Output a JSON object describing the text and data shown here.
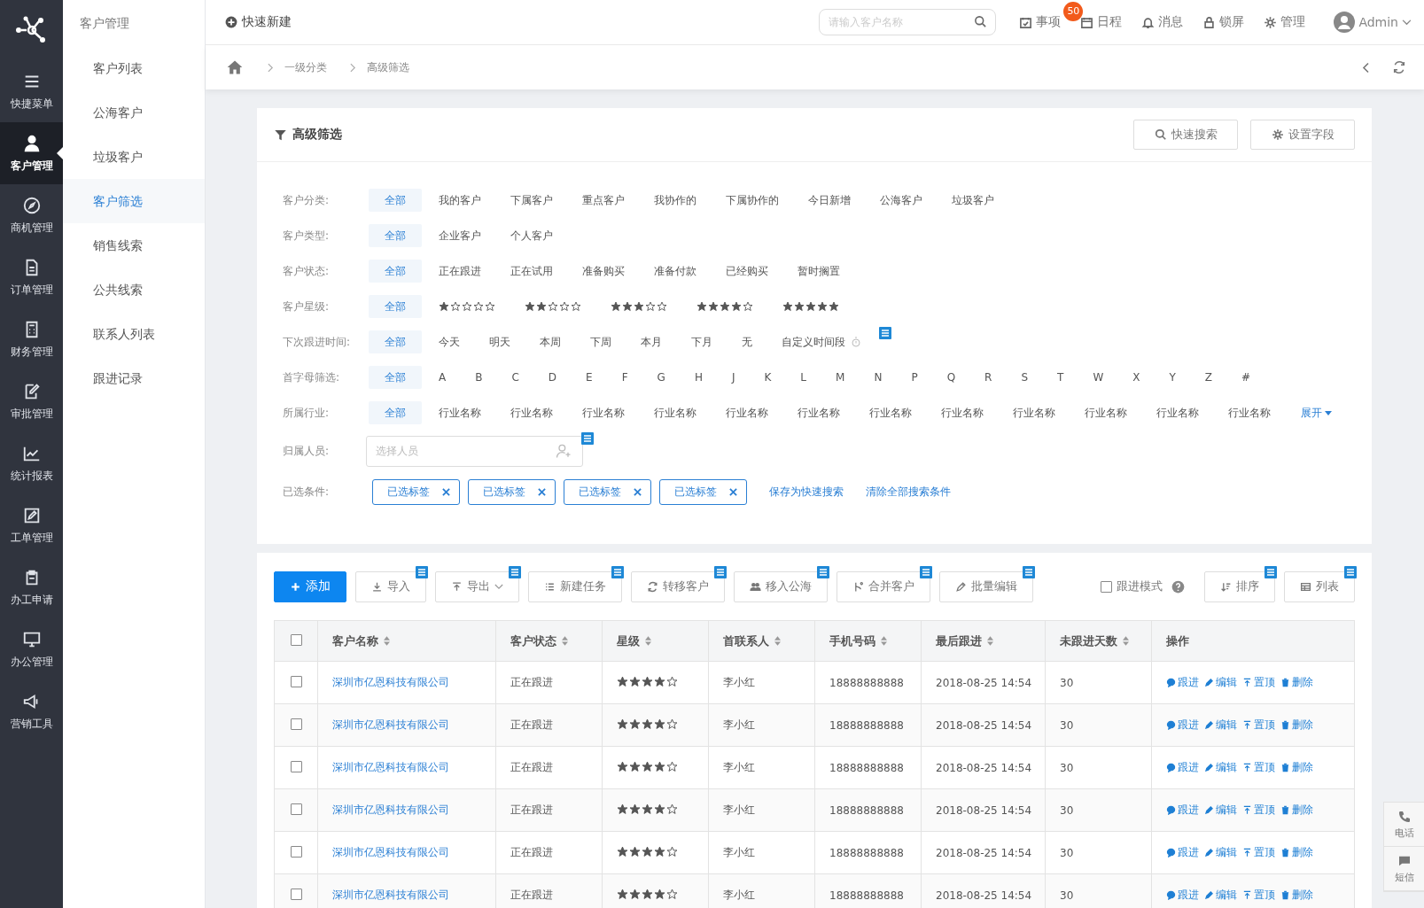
{
  "rail": {
    "items": [
      {
        "label": "快捷菜单",
        "selected": false
      },
      {
        "label": "客户管理",
        "selected": true
      },
      {
        "label": "商机管理",
        "selected": false
      },
      {
        "label": "订单管理",
        "selected": false
      },
      {
        "label": "财务管理",
        "selected": false
      },
      {
        "label": "审批管理",
        "selected": false
      },
      {
        "label": "统计报表",
        "selected": false
      },
      {
        "label": "工单管理",
        "selected": false
      },
      {
        "label": "办工申请",
        "selected": false
      },
      {
        "label": "办公管理",
        "selected": false
      },
      {
        "label": "营销工具",
        "selected": false
      }
    ]
  },
  "subnav": {
    "title": "客户管理",
    "items": [
      {
        "label": "客户列表",
        "selected": false
      },
      {
        "label": "公海客户",
        "selected": false
      },
      {
        "label": "垃圾客户",
        "selected": false
      },
      {
        "label": "客户筛选",
        "selected": true
      },
      {
        "label": "销售线索",
        "selected": false
      },
      {
        "label": "公共线索",
        "selected": false
      },
      {
        "label": "联系人列表",
        "selected": false
      },
      {
        "label": "跟进记录",
        "selected": false
      }
    ]
  },
  "topbar": {
    "quick_new": "快速新建",
    "search": {
      "placeholder": "请输入客户名称"
    },
    "actions": [
      {
        "label": "事项",
        "badge": "50"
      },
      {
        "label": "日程"
      },
      {
        "label": "消息"
      },
      {
        "label": "锁屏"
      },
      {
        "label": "管理"
      }
    ],
    "user": "Admin"
  },
  "breadcrumb": {
    "items": [
      "一级分类",
      "高级筛选"
    ]
  },
  "filter": {
    "title": "高级筛选",
    "buttons": [
      "快速搜索",
      "设置字段"
    ],
    "rows": [
      {
        "label": "客户分类:",
        "kind": "options",
        "options": [
          {
            "label": "全部",
            "selected": true
          },
          {
            "label": "我的客户",
            "selected": false
          },
          {
            "label": "下属客户",
            "selected": false
          },
          {
            "label": "重点客户",
            "selected": false
          },
          {
            "label": "我协作的",
            "selected": false
          },
          {
            "label": "下属协作的",
            "selected": false
          },
          {
            "label": "今日新增",
            "selected": false
          },
          {
            "label": "公海客户",
            "selected": false
          },
          {
            "label": "垃圾客户",
            "selected": false
          }
        ]
      },
      {
        "label": "客户类型:",
        "kind": "options",
        "options": [
          {
            "label": "全部",
            "selected": true
          },
          {
            "label": "企业客户",
            "selected": false
          },
          {
            "label": "个人客户",
            "selected": false
          }
        ]
      },
      {
        "label": "客户状态:",
        "kind": "options",
        "options": [
          {
            "label": "全部",
            "selected": true
          },
          {
            "label": "正在跟进",
            "selected": false
          },
          {
            "label": "正在试用",
            "selected": false
          },
          {
            "label": "准备购买",
            "selected": false
          },
          {
            "label": "准备付款",
            "selected": false
          },
          {
            "label": "已经购买",
            "selected": false
          },
          {
            "label": "暂时搁置",
            "selected": false
          }
        ]
      },
      {
        "label": "客户星级:",
        "kind": "options",
        "options": [
          {
            "label": "全部",
            "selected": true
          },
          {
            "stars": 1,
            "selected": false
          },
          {
            "stars": 2,
            "selected": false
          },
          {
            "stars": 3,
            "selected": false
          },
          {
            "stars": 4,
            "selected": false
          },
          {
            "stars": 5,
            "selected": false
          }
        ]
      },
      {
        "label": "下次跟进时间:",
        "kind": "options",
        "options": [
          {
            "label": "全部",
            "selected": true
          },
          {
            "label": "今天",
            "selected": false
          },
          {
            "label": "明天",
            "selected": false
          },
          {
            "label": "本周",
            "selected": false
          },
          {
            "label": "下周",
            "selected": false
          },
          {
            "label": "本月",
            "selected": false
          },
          {
            "label": "下月",
            "selected": false
          },
          {
            "label": "无",
            "selected": false
          },
          {
            "label": "自定义时间段",
            "selected": false,
            "clock": true
          }
        ],
        "note": true
      },
      {
        "label": "首字母筛选:",
        "kind": "options",
        "options": [
          {
            "label": "全部",
            "selected": true
          },
          {
            "label": "A",
            "selected": false
          },
          {
            "label": "B",
            "selected": false
          },
          {
            "label": "C",
            "selected": false
          },
          {
            "label": "D",
            "selected": false
          },
          {
            "label": "E",
            "selected": false
          },
          {
            "label": "F",
            "selected": false
          },
          {
            "label": "G",
            "selected": false
          },
          {
            "label": "H",
            "selected": false
          },
          {
            "label": "J",
            "selected": false
          },
          {
            "label": "K",
            "selected": false
          },
          {
            "label": "L",
            "selected": false
          },
          {
            "label": "M",
            "selected": false
          },
          {
            "label": "N",
            "selected": false
          },
          {
            "label": "P",
            "selected": false
          },
          {
            "label": "Q",
            "selected": false
          },
          {
            "label": "R",
            "selected": false
          },
          {
            "label": "S",
            "selected": false
          },
          {
            "label": "T",
            "selected": false
          },
          {
            "label": "W",
            "selected": false
          },
          {
            "label": "X",
            "selected": false
          },
          {
            "label": "Y",
            "selected": false
          },
          {
            "label": "Z",
            "selected": false
          },
          {
            "label": "#",
            "selected": false
          }
        ]
      },
      {
        "label": "所属行业:",
        "kind": "options",
        "options": [
          {
            "label": "全部",
            "selected": true
          },
          {
            "label": "行业名称",
            "selected": false
          },
          {
            "label": "行业名称",
            "selected": false
          },
          {
            "label": "行业名称",
            "selected": false
          },
          {
            "label": "行业名称",
            "selected": false
          },
          {
            "label": "行业名称",
            "selected": false
          },
          {
            "label": "行业名称",
            "selected": false
          },
          {
            "label": "行业名称",
            "selected": false
          },
          {
            "label": "行业名称",
            "selected": false
          },
          {
            "label": "行业名称",
            "selected": false
          },
          {
            "label": "行业名称",
            "selected": false
          },
          {
            "label": "行业名称",
            "selected": false
          },
          {
            "label": "行业名称",
            "selected": false
          }
        ],
        "more": "展开"
      },
      {
        "label": "归属人员:",
        "kind": "input",
        "placeholder": "选择人员",
        "note": true
      },
      {
        "label": "已选条件:",
        "kind": "tags",
        "tags": [
          "已选标签",
          "已选标签",
          "已选标签",
          "已选标签"
        ],
        "links": [
          "保存为快速搜索",
          "清除全部搜索条件"
        ]
      }
    ]
  },
  "toolbar": {
    "buttons": [
      {
        "label": "添加",
        "kind": "primary",
        "note": false
      },
      {
        "label": "导入",
        "kind": "default",
        "note": true
      },
      {
        "label": "导出",
        "kind": "dropdown",
        "note": true
      },
      {
        "label": "新建任务",
        "kind": "default",
        "note": true
      },
      {
        "label": "转移客户",
        "kind": "default",
        "note": true
      },
      {
        "label": "移入公海",
        "kind": "default",
        "note": true
      },
      {
        "label": "合并客户",
        "kind": "default",
        "note": true
      },
      {
        "label": "批量编辑",
        "kind": "default",
        "note": true
      }
    ],
    "follow_mode": {
      "label": "跟进模式",
      "checked": false
    },
    "right_buttons": [
      {
        "label": "排序",
        "note": true
      },
      {
        "label": "列表",
        "note": true
      }
    ]
  },
  "table": {
    "all_checked": false,
    "columns": [
      "客户名称",
      "客户状态",
      "星级",
      "首联系人",
      "手机号码",
      "最后跟进",
      "未跟进天数",
      "操作"
    ],
    "rows": [
      {
        "checked": false,
        "name": "深圳市亿恩科技有限公司",
        "status": "正在跟进",
        "stars": 4,
        "contact": "李小红",
        "phone": "18888888888",
        "last": "2018-08-25 14:54",
        "days": "30",
        "actions": [
          "跟进",
          "编辑",
          "置顶",
          "删除"
        ]
      },
      {
        "checked": false,
        "name": "深圳市亿恩科技有限公司",
        "status": "正在跟进",
        "stars": 4,
        "contact": "李小红",
        "phone": "18888888888",
        "last": "2018-08-25 14:54",
        "days": "30",
        "actions": [
          "跟进",
          "编辑",
          "置顶",
          "删除"
        ]
      },
      {
        "checked": false,
        "name": "深圳市亿恩科技有限公司",
        "status": "正在跟进",
        "stars": 4,
        "contact": "李小红",
        "phone": "18888888888",
        "last": "2018-08-25 14:54",
        "days": "30",
        "actions": [
          "跟进",
          "编辑",
          "置顶",
          "删除"
        ]
      },
      {
        "checked": false,
        "name": "深圳市亿恩科技有限公司",
        "status": "正在跟进",
        "stars": 4,
        "contact": "李小红",
        "phone": "18888888888",
        "last": "2018-08-25 14:54",
        "days": "30",
        "actions": [
          "跟进",
          "编辑",
          "置顶",
          "删除"
        ]
      },
      {
        "checked": false,
        "name": "深圳市亿恩科技有限公司",
        "status": "正在跟进",
        "stars": 4,
        "contact": "李小红",
        "phone": "18888888888",
        "last": "2018-08-25 14:54",
        "days": "30",
        "actions": [
          "跟进",
          "编辑",
          "置顶",
          "删除"
        ]
      },
      {
        "checked": false,
        "name": "深圳市亿恩科技有限公司",
        "status": "正在跟进",
        "stars": 4,
        "contact": "李小红",
        "phone": "18888888888",
        "last": "2018-08-25 14:54",
        "days": "30",
        "actions": [
          "跟进",
          "编辑",
          "置顶",
          "删除"
        ]
      }
    ]
  },
  "side_widget": [
    "电话",
    "短信"
  ]
}
